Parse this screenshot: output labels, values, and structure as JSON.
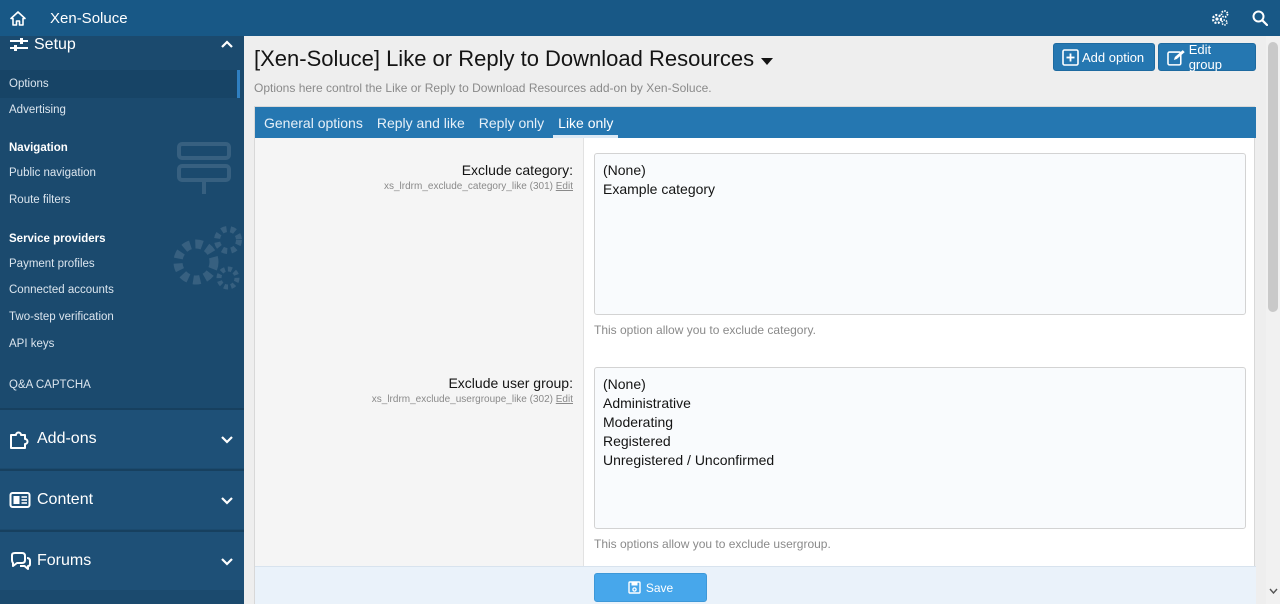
{
  "topbar": {
    "brand": "Xen-Soluce",
    "home_icon": "home-icon",
    "cog_icon": "cogs-icon",
    "search_icon": "search-icon"
  },
  "sidebar": {
    "setup_label": "Setup",
    "items": {
      "options": "Options",
      "advertising": "Advertising",
      "navigation_heading": "Navigation",
      "public_navigation": "Public navigation",
      "route_filters": "Route filters",
      "service_providers_heading": "Service providers",
      "payment_profiles": "Payment profiles",
      "connected_accounts": "Connected accounts",
      "two_step": "Two-step verification",
      "api_keys": "API keys",
      "qa_captcha": "Q&A CAPTCHA"
    },
    "sections": {
      "addons": "Add-ons",
      "content": "Content",
      "forums": "Forums"
    }
  },
  "page": {
    "title": "[Xen-Soluce] Like or Reply to Download Resources",
    "description": "Options here control the Like or Reply to Download Resources add-on by Xen-Soluce.",
    "add_option": "Add option",
    "edit_group": "Edit group"
  },
  "tabs": [
    "General options",
    "Reply and like",
    "Reply only",
    "Like only"
  ],
  "options": {
    "category": {
      "label": "Exclude category:",
      "hint": "xs_lrdrm_exclude_category_like (301)",
      "edit": "Edit",
      "values": [
        "(None)",
        "Example category"
      ],
      "explain": "This option allow you to exclude category."
    },
    "usergroup": {
      "label": "Exclude user group:",
      "hint": "xs_lrdrm_exclude_usergroupe_like (302)",
      "edit": "Edit",
      "values": [
        "(None)",
        "Administrative",
        "Moderating",
        "Registered",
        "Unregistered / Unconfirmed"
      ],
      "explain": "This options allow you to exclude usergroup."
    }
  },
  "footer": {
    "save": "Save"
  },
  "colors": {
    "topbar": "#185886",
    "sidebar": "#1b4a6e",
    "accent": "#2577b1",
    "save": "#47a7eb"
  }
}
